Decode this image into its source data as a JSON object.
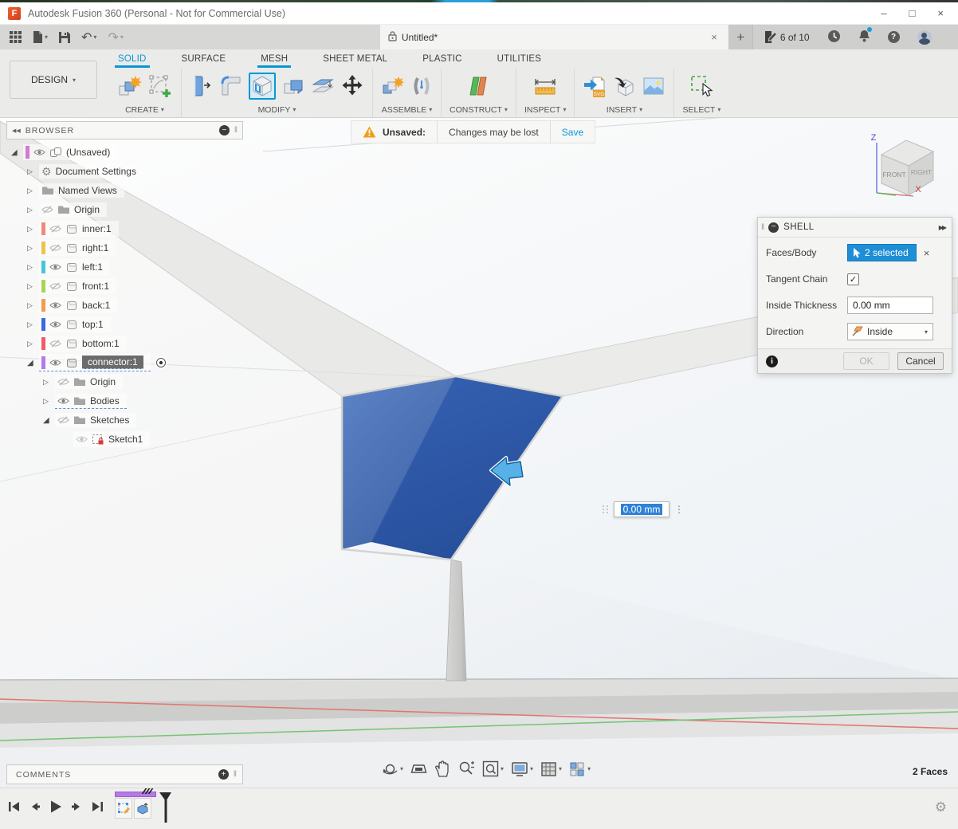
{
  "titlebar": {
    "title": "Autodesk Fusion 360 (Personal - Not for Commercial Use)"
  },
  "doc_tab": {
    "title": "Untitled*"
  },
  "account": {
    "job_progress": "6 of 10"
  },
  "tabs": [
    {
      "label": "SOLID",
      "active": true
    },
    {
      "label": "SURFACE"
    },
    {
      "label": "MESH",
      "underline": true
    },
    {
      "label": "SHEET METAL"
    },
    {
      "label": "PLASTIC"
    },
    {
      "label": "UTILITIES"
    }
  ],
  "ribbon": {
    "design": "DESIGN",
    "groups": {
      "create": "CREATE",
      "modify": "MODIFY",
      "assemble": "ASSEMBLE",
      "construct": "CONSTRUCT",
      "inspect": "INSPECT",
      "insert": "INSERT",
      "select": "SELECT"
    },
    "insert_svg_badge": "SVG"
  },
  "browser": {
    "title": "BROWSER",
    "items": [
      {
        "label": "(Unsaved)",
        "color": "#d478d4"
      },
      {
        "label": "Document Settings"
      },
      {
        "label": "Named Views"
      },
      {
        "label": "Origin"
      },
      {
        "label": "inner:1",
        "color": "#f0897b"
      },
      {
        "label": "right:1",
        "color": "#e9c54b"
      },
      {
        "label": "left:1",
        "color": "#45c6d8"
      },
      {
        "label": "front:1",
        "color": "#a8d64f"
      },
      {
        "label": "back:1",
        "color": "#f09d50"
      },
      {
        "label": "top:1",
        "color": "#3b69e2"
      },
      {
        "label": "bottom:1",
        "color": "#f25a69"
      },
      {
        "label": "connector:1",
        "color": "#b579e8",
        "selected": true
      },
      {
        "label": "Origin"
      },
      {
        "label": "Bodies"
      },
      {
        "label": "Sketches"
      },
      {
        "label": "Sketch1"
      }
    ]
  },
  "warning": {
    "label": "Unsaved:",
    "message": "Changes may be lost",
    "save": "Save"
  },
  "shell": {
    "title": "SHELL",
    "faces_label": "Faces/Body",
    "faces_value": "2 selected",
    "tangent_label": "Tangent Chain",
    "tangent_mark": "✓",
    "thickness_label": "Inside Thickness",
    "thickness_value": "0.00 mm",
    "direction_label": "Direction",
    "direction_value": "Inside",
    "ok": "OK",
    "cancel": "Cancel"
  },
  "viewcube": {
    "front": "FRONT",
    "right": "RIGHT",
    "axis_z": "Z",
    "axis_x": "X"
  },
  "manipulator": {
    "value": "0.00 mm"
  },
  "comments": {
    "title": "COMMENTS"
  },
  "status": {
    "selection_info": "2 Faces"
  },
  "icons": {
    "help": "?",
    "info": "i",
    "gear": "⚙",
    "undo": "↶",
    "redo": "↷",
    "caret": "▾",
    "close": "×",
    "minimize": "–",
    "maximize": "□",
    "dots": "⋮",
    "grip": "‖",
    "collapse_left": "◀◀",
    "tri_open": "◢",
    "tri_closed": "▷",
    "plus": "+",
    "minus": "−",
    "expand_right": "▶▶",
    "alert": "!"
  },
  "colors": {
    "accent": "#0a96d4",
    "face_selected": "#2e57a7",
    "face_selected_light": "#4d74b8",
    "timeline_group": "#b579e8"
  }
}
